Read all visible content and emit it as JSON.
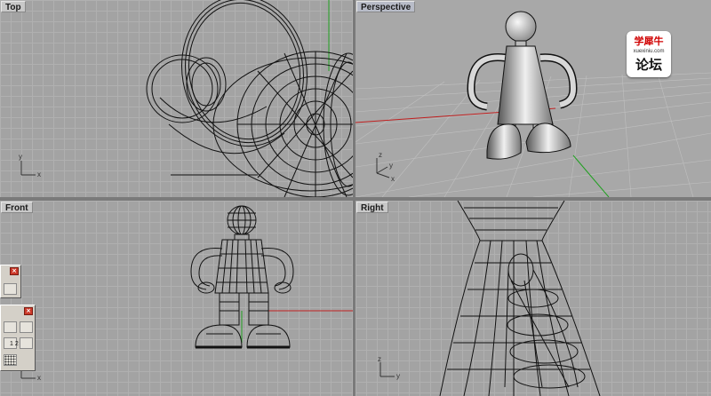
{
  "viewports": {
    "top": {
      "title": "Top"
    },
    "perspective": {
      "title": "Perspective"
    },
    "front": {
      "title": "Front"
    },
    "right": {
      "title": "Right"
    }
  },
  "axes": {
    "x": "x",
    "y": "y",
    "z": "z"
  },
  "watermark": {
    "line1": "学犀牛",
    "line2": "xuexiniu.com",
    "line3": "论坛"
  },
  "toolbars": {
    "close_glyph": "×",
    "page_label": "1 2"
  },
  "colors": {
    "viewport_bg": "#a3a3a3",
    "grid": "#b0b0b0",
    "wire": "#111111",
    "x_axis": "#c02020",
    "y_axis": "#20a020",
    "close_button": "#cc3a2a"
  }
}
